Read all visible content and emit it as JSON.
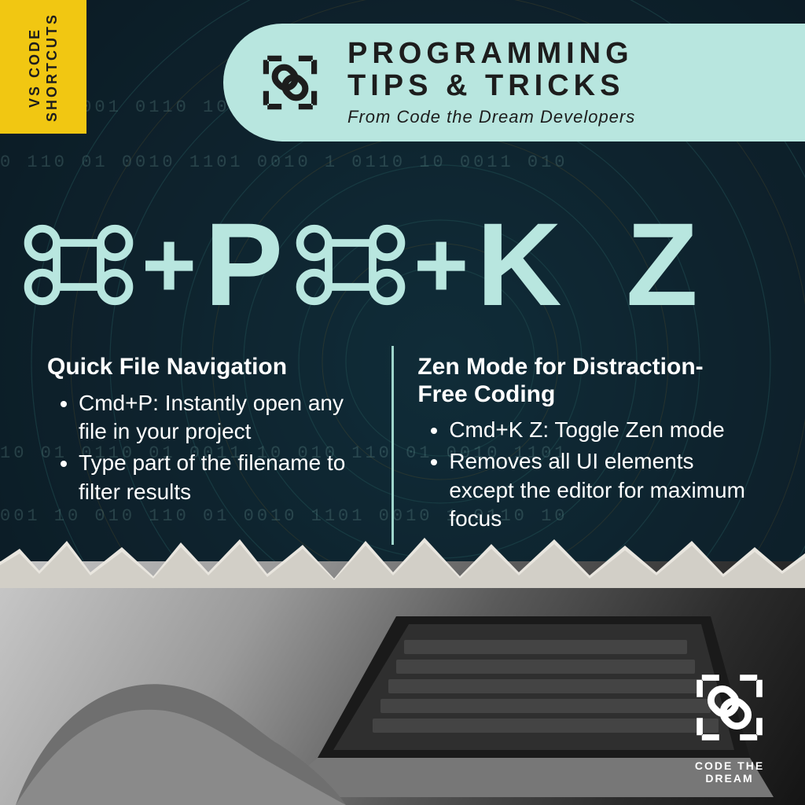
{
  "colors": {
    "accent": "#b8e6df",
    "tag": "#f1c712",
    "dark": "#0e1f2a"
  },
  "tag": {
    "line1": "VS CODE",
    "line2": "SHORTCUTS"
  },
  "header": {
    "title_line1": "PROGRAMMING",
    "title_line2": "TIPS & TRICKS",
    "subtitle": "From Code the Dream Developers",
    "icon_name": "chain-link-icon"
  },
  "shortcuts": {
    "left": {
      "symbol": "cmd",
      "plus": "+",
      "keys": "P"
    },
    "right": {
      "symbol": "cmd",
      "plus": "+",
      "keys": "K Z"
    }
  },
  "descriptions": {
    "left": {
      "heading": "Quick File Navigation",
      "bullets": [
        "Cmd+P: Instantly open any file in your project",
        "Type part of the filename to filter results"
      ]
    },
    "right": {
      "heading": "Zen Mode for Distraction-Free Coding",
      "bullets": [
        "Cmd+K Z: Toggle Zen mode",
        "Removes all UI elements except the editor for maximum focus"
      ]
    }
  },
  "footer": {
    "brand": "CODE THE DREAM",
    "icon_name": "chain-link-icon"
  }
}
